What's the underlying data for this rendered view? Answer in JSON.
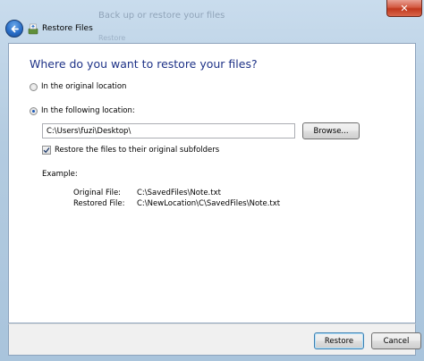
{
  "window": {
    "title": "Restore Files",
    "close_symbol": "✕",
    "background_title": "Back up or restore your files",
    "background_sub": "Restore"
  },
  "main": {
    "heading": "Where do you want to restore your files?",
    "option_original": "In the original location",
    "option_following": "In the following location:",
    "path_value": "C:\\Users\\fuzi\\Desktop\\",
    "browse_label": "Browse...",
    "checkbox_label": "Restore the files to their original subfolders",
    "example_label": "Example:",
    "original_file_label": "Original File:",
    "original_file_value": "C:\\SavedFiles\\Note.txt",
    "restored_file_label": "Restored File:",
    "restored_file_value": "C:\\NewLocation\\C\\SavedFiles\\Note.txt"
  },
  "footer": {
    "restore_label": "Restore",
    "cancel_label": "Cancel"
  },
  "colors": {
    "heading": "#1e3287",
    "frame": "#b3cbe0",
    "close_button": "#c0381e"
  }
}
